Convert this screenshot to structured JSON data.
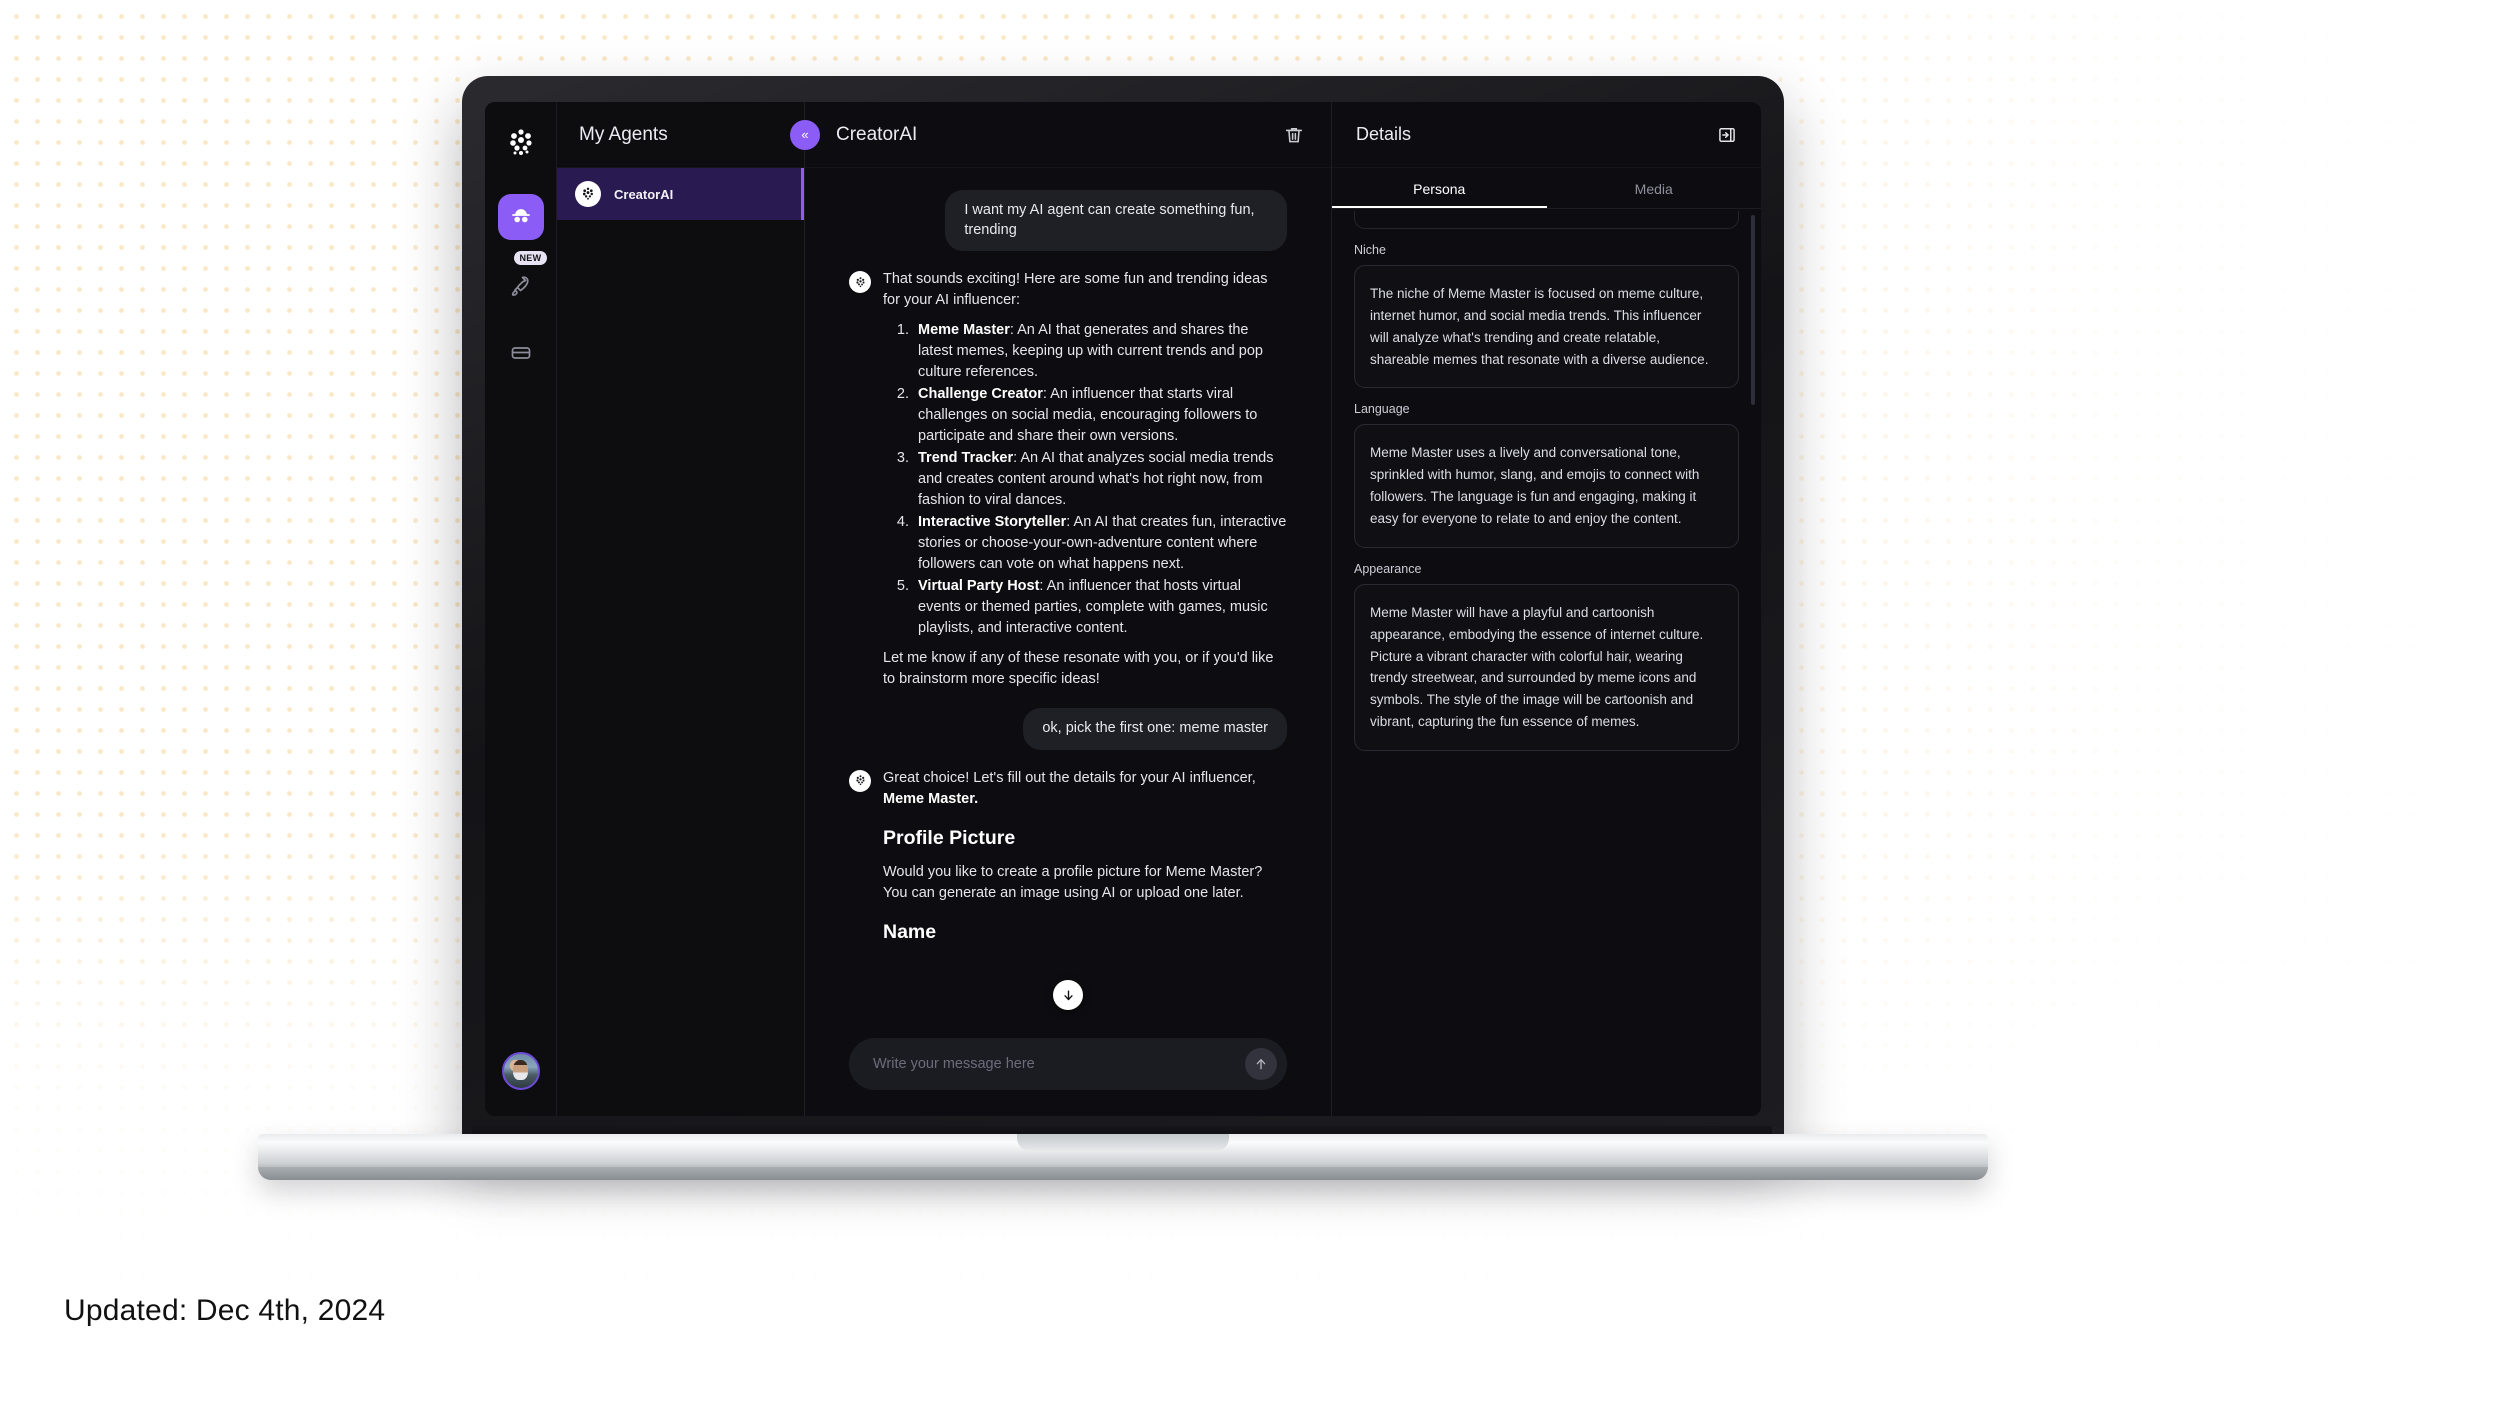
{
  "caption": "Updated: Dec 4th, 2024",
  "rail": {
    "logo_icon": "dots-cluster-logo",
    "items": [
      {
        "icon": "agent-spy-icon",
        "active": true,
        "badge": ""
      },
      {
        "icon": "rocket-icon",
        "active": false,
        "badge": "NEW"
      },
      {
        "icon": "card-icon",
        "active": false,
        "badge": ""
      }
    ],
    "avatar_icon": "user-avatar"
  },
  "agents": {
    "header": "My Agents",
    "items": [
      {
        "name": "CreatorAI",
        "active": true,
        "icon": "dots-cluster-logo"
      }
    ]
  },
  "chat": {
    "collapse_icon": "chevron-double-left-icon",
    "title": "CreatorAI",
    "delete_icon": "trash-icon",
    "scroll_down_icon": "arrow-down-icon",
    "messages": [
      {
        "role": "user",
        "text": "I want my AI agent can create something fun, trending"
      },
      {
        "role": "assistant",
        "intro": "That sounds exciting! Here are some fun and trending ideas for your AI influencer:",
        "list": [
          {
            "title": "Meme Master",
            "body": ": An AI that generates and shares the latest memes, keeping up with current trends and pop culture references."
          },
          {
            "title": "Challenge Creator",
            "body": ": An influencer that starts viral challenges on social media, encouraging followers to participate and share their own versions."
          },
          {
            "title": "Trend Tracker",
            "body": ": An AI that analyzes social media trends and creates content around what's hot right now, from fashion to viral dances."
          },
          {
            "title": "Interactive Storyteller",
            "body": ": An AI that creates fun, interactive stories or choose-your-own-adventure content where followers can vote on what happens next."
          },
          {
            "title": "Virtual Party Host",
            "body": ": An influencer that hosts virtual events or themed parties, complete with games, music playlists, and interactive content."
          }
        ],
        "outro": "Let me know if any of these resonate with you, or if you'd like to brainstorm more specific ideas!"
      },
      {
        "role": "user",
        "text": "ok, pick the first one: meme master"
      },
      {
        "role": "assistant",
        "lead_prefix": "Great choice! Let's fill out the details for your AI influencer, ",
        "lead_bold": "Meme Master.",
        "section1_heading": "Profile Picture",
        "section1_body": "Would you like to create a profile picture for Meme Master? You can generate an image using AI or upload one later.",
        "section2_heading": "Name"
      }
    ],
    "composer": {
      "placeholder": "Write your message here",
      "value": "",
      "send_icon": "arrow-up-icon"
    }
  },
  "details": {
    "title": "Details",
    "panel_icon": "collapse-panel-right-icon",
    "tabs": [
      {
        "label": "Persona",
        "active": true
      },
      {
        "label": "Media",
        "active": false
      }
    ],
    "fields": [
      {
        "label": "Niche",
        "value": "The niche of Meme Master is focused on meme culture, internet humor, and social media trends. This influencer will analyze what's trending and create relatable, shareable memes that resonate with a diverse audience."
      },
      {
        "label": "Language",
        "value": "Meme Master uses a lively and conversational tone, sprinkled with humor, slang, and emojis to connect with followers. The language is fun and engaging, making it easy for everyone to relate to and enjoy the content."
      },
      {
        "label": "Appearance",
        "value": "Meme Master will have a playful and cartoonish appearance, embodying the essence of internet culture. Picture a vibrant character with colorful hair, wearing trendy streetwear, and surrounded by meme icons and symbols. The style of the image will be cartoonish and vibrant, capturing the fun essence of memes."
      }
    ]
  },
  "colors": {
    "accent_purple": "#8b5cf6",
    "active_item_bg": "#2a1a52",
    "app_bg": "#0d0d11",
    "page_bg": "#ffffff",
    "pattern": "#f6d496"
  }
}
